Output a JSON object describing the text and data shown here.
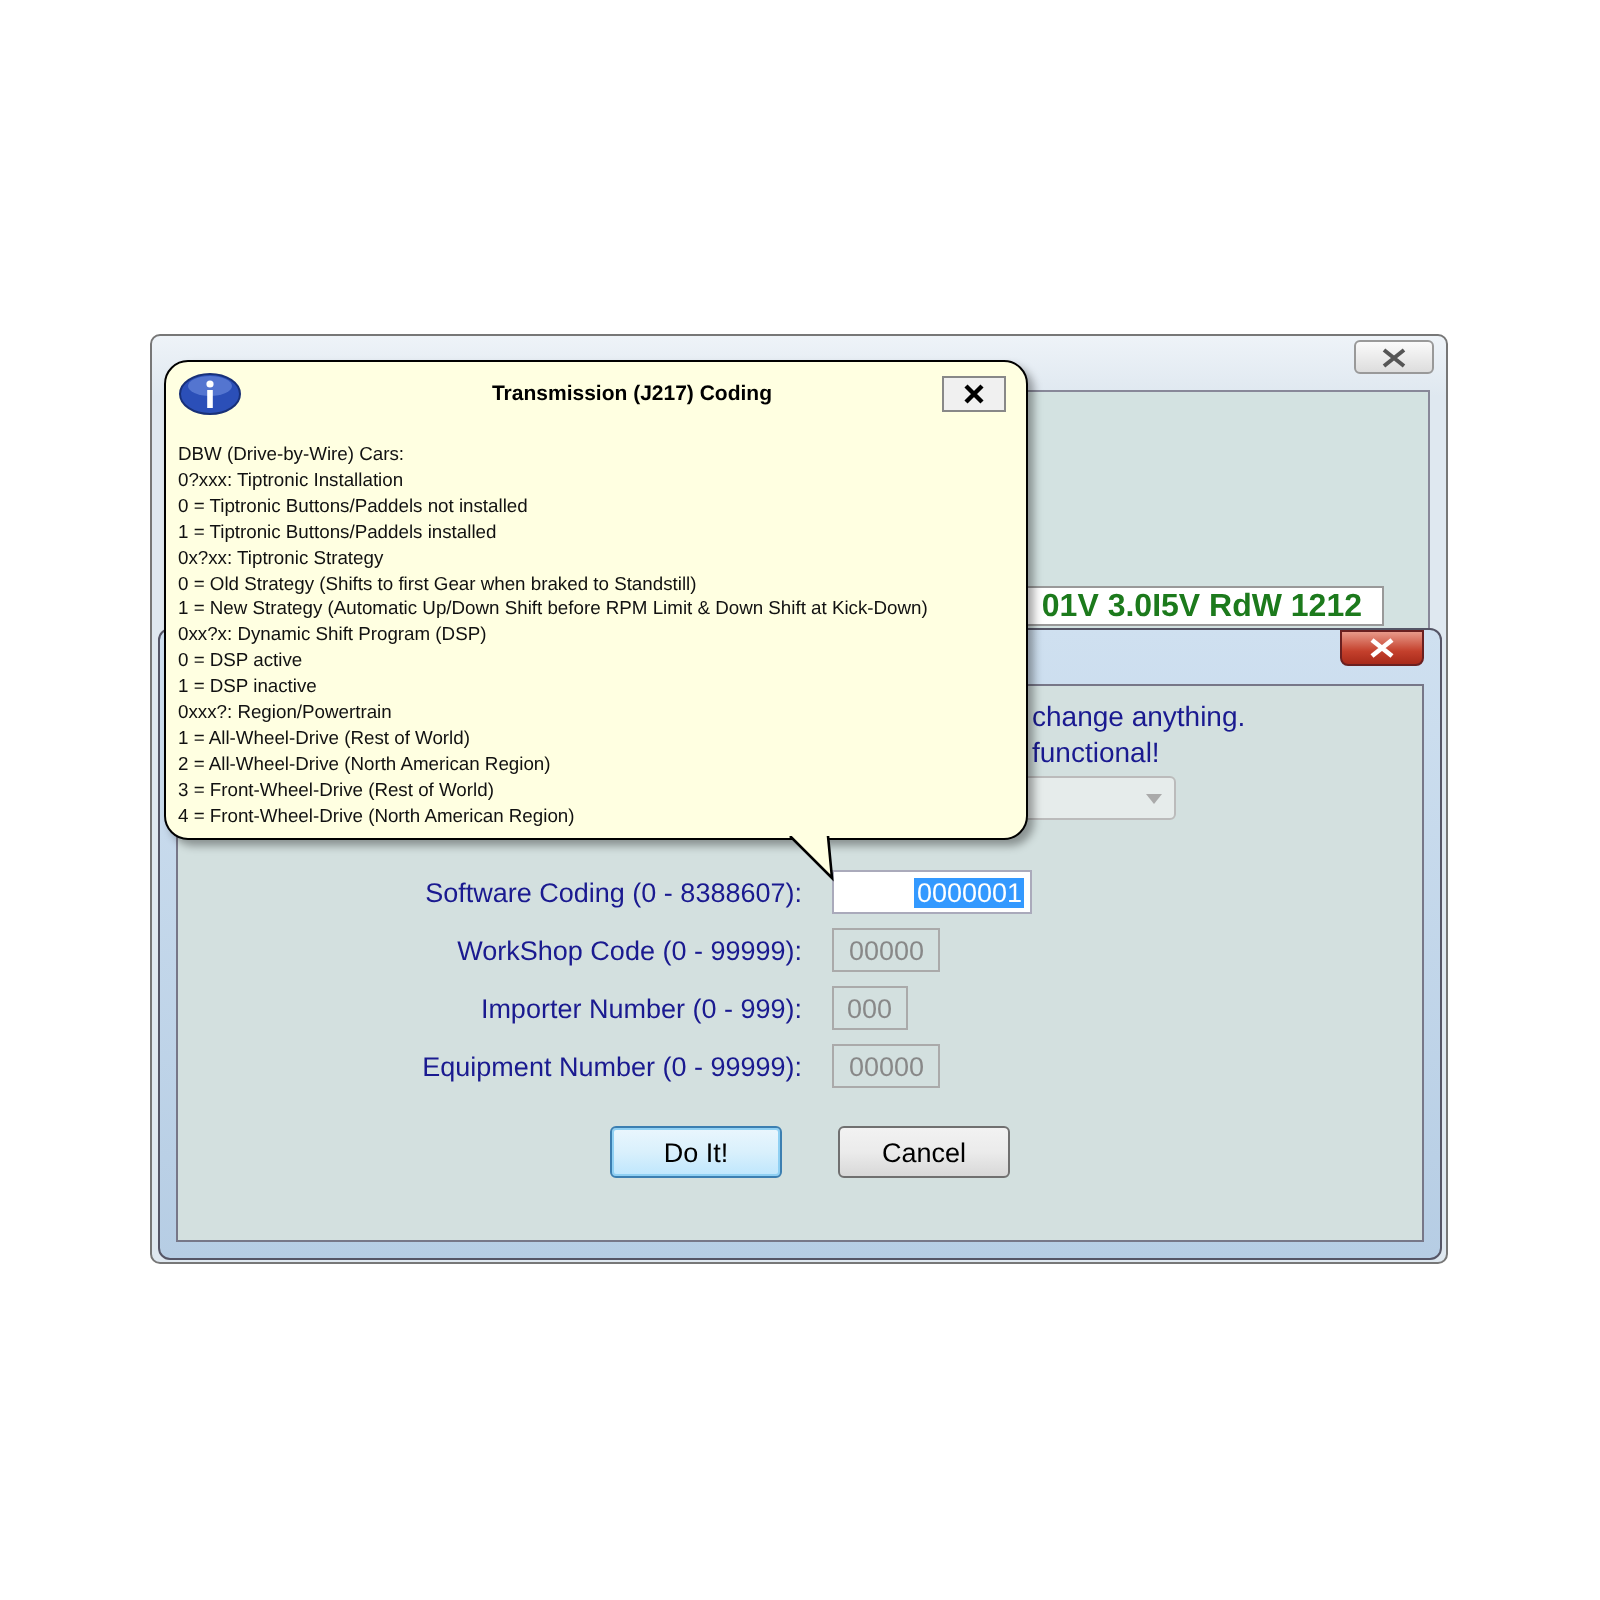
{
  "background_window": {
    "status_readout": "01V 3.0I5V  RdW 1212"
  },
  "dialog": {
    "message_lines": [
      "change anything.",
      "functional!"
    ],
    "dropdown": {
      "disabled": true
    },
    "fields": [
      {
        "label": "Software Coding (0 - 8388607):",
        "value": "0000001",
        "disabled": false,
        "selected": true
      },
      {
        "label": "WorkShop Code (0 - 99999):",
        "value": "00000",
        "disabled": true,
        "selected": false
      },
      {
        "label": "Importer Number (0 - 999):",
        "value": "000",
        "disabled": true,
        "selected": false
      },
      {
        "label": "Equipment Number (0 - 99999):",
        "value": "00000",
        "disabled": true,
        "selected": false
      }
    ],
    "buttons": [
      {
        "label": "Do It!",
        "default": true
      },
      {
        "label": "Cancel",
        "default": false
      }
    ]
  },
  "balloon": {
    "title": "Transmission (J217) Coding",
    "lines": [
      "DBW (Drive-by-Wire) Cars:",
      "0?xxx: Tiptronic Installation",
      "0 = Tiptronic Buttons/Paddels not installed",
      "1 = Tiptronic Buttons/Paddels installed",
      "0x?xx: Tiptronic Strategy",
      "0 = Old Strategy (Shifts to first Gear when braked to Standstill)",
      "1 = New Strategy (Automatic Up/Down Shift before RPM Limit & Down Shift at Kick-Down)",
      "0xx?x: Dynamic Shift Program (DSP)",
      "0 = DSP active",
      "1 = DSP inactive",
      "0xxx?: Region/Powertrain",
      "1 = All-Wheel-Drive (Rest of World)",
      "2 = All-Wheel-Drive (North American Region)",
      "3 = Front-Wheel-Drive (Rest of World)",
      "4 = Front-Wheel-Drive (North American Region)"
    ]
  }
}
